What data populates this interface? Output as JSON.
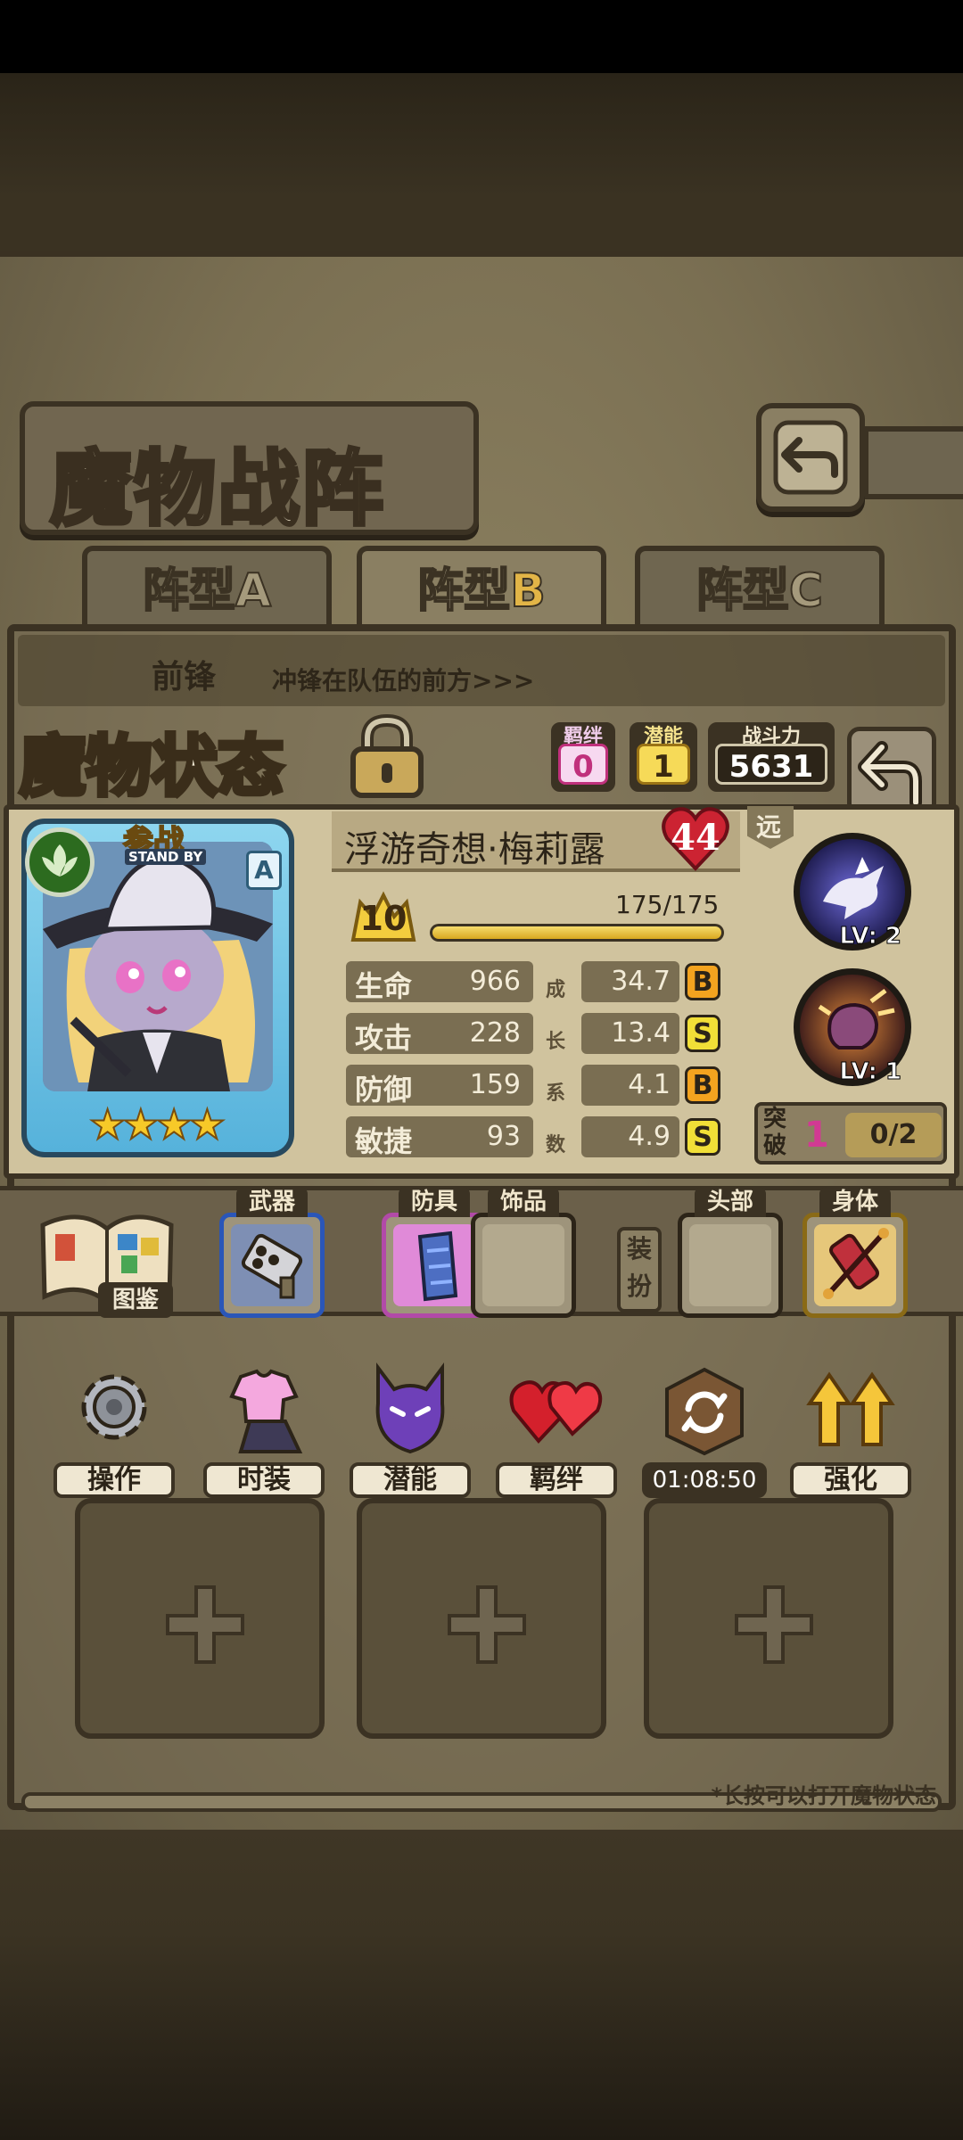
{
  "screen": {
    "title": "魔物战阵",
    "tabs": [
      {
        "label_main": "阵型",
        "label_suffix": "A",
        "active": false
      },
      {
        "label_main": "阵型",
        "label_suffix": "B",
        "active": true
      },
      {
        "label_main": "阵型",
        "label_suffix": "C",
        "active": false
      }
    ],
    "front_row": {
      "name": "前锋",
      "desc": "冲锋在队伍的前方>>>"
    },
    "hint": "*长按可以打开魔物状态"
  },
  "status": {
    "title": "魔物状态",
    "bond": {
      "label": "羁绊",
      "value": "0"
    },
    "potential": {
      "label": "潜能",
      "value": "1"
    },
    "power": {
      "label": "战斗力",
      "value": "5631"
    },
    "card": {
      "standby_zh": "参战",
      "standby_en": "STAND BY",
      "rank": "A",
      "stars": "★★★★"
    },
    "name": "浮游奇想·梅莉露",
    "heart_value": "44",
    "level": "10",
    "exp_text": "175/175",
    "exp_fraction": 1.0,
    "stats": [
      {
        "label": "生命",
        "value": "966",
        "growth": "34.7",
        "grade": "B"
      },
      {
        "label": "攻击",
        "value": "228",
        "growth": "13.4",
        "grade": "S"
      },
      {
        "label": "防御",
        "value": "159",
        "growth": "4.1",
        "grade": "B"
      },
      {
        "label": "敏捷",
        "value": "93",
        "growth": "4.9",
        "grade": "S"
      }
    ],
    "growth_label": [
      "成",
      "长",
      "系",
      "数"
    ],
    "range": "远",
    "skills": [
      {
        "name": "crow-skill-icon",
        "level": "LV: 2"
      },
      {
        "name": "fist-skill-icon",
        "level": "LV: 1"
      }
    ],
    "breakthrough": {
      "label": "突破",
      "value": "1",
      "progress": "0/2"
    }
  },
  "equipment": {
    "codex_label": "图鉴",
    "slots": [
      {
        "tag": "武器",
        "filled": true,
        "color": "#3f6fd6"
      },
      {
        "tag": "防具",
        "filled": true,
        "color": "#d86bd0"
      },
      {
        "tag": "饰品",
        "filled": false,
        "color": "#9e947b"
      }
    ],
    "zhuang_label": "装扮",
    "costume_slots": [
      {
        "tag": "头部",
        "filled": false,
        "color": "#9e947b"
      },
      {
        "tag": "身体",
        "filled": true,
        "color": "#e6b33b"
      }
    ]
  },
  "actions": [
    {
      "label": "操作",
      "icon": "gear-icon"
    },
    {
      "label": "时装",
      "icon": "outfit-icon"
    },
    {
      "label": "潜能",
      "icon": "demon-icon"
    },
    {
      "label": "羁绊",
      "icon": "hearts-icon"
    },
    {
      "label": "01:08:50",
      "icon": "chest-refresh-icon",
      "is_timer": true
    },
    {
      "label": "强化",
      "icon": "upgrade-arrows-icon"
    }
  ]
}
